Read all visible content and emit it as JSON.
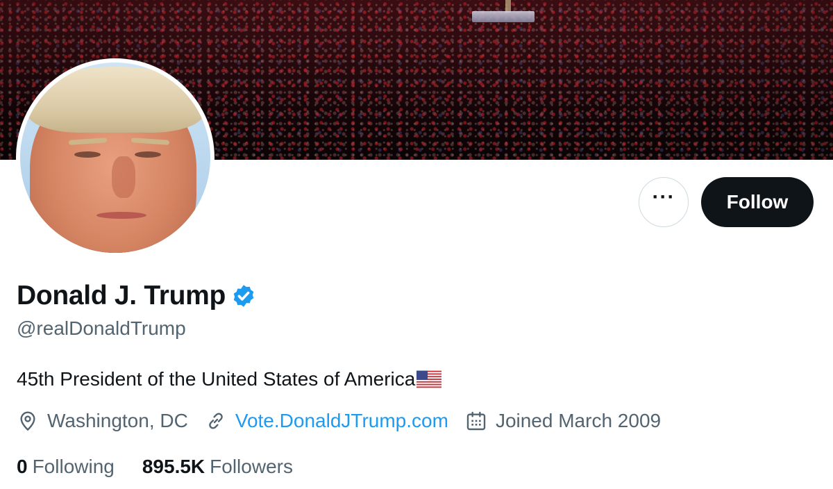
{
  "profile": {
    "display_name": "Donald J. Trump",
    "handle": "@realDonaldTrump",
    "verified": true,
    "bio": "45th President of the United States of America",
    "bio_emoji": "us-flag-icon",
    "location": "Washington, DC",
    "website": "Vote.DonaldJTrump.com",
    "joined": "Joined March 2009"
  },
  "actions": {
    "more_label": "···",
    "follow_label": "Follow"
  },
  "stats": {
    "following_count": "0",
    "following_label": "Following",
    "followers_count": "895.5K",
    "followers_label": "Followers"
  },
  "colors": {
    "accent": "#1d9bf0",
    "text_primary": "#0f1419",
    "text_secondary": "#536471",
    "follow_bg": "#0f1419"
  },
  "icons": [
    "location-pin-icon",
    "link-icon",
    "calendar-icon",
    "verified-badge-icon",
    "more-icon"
  ]
}
